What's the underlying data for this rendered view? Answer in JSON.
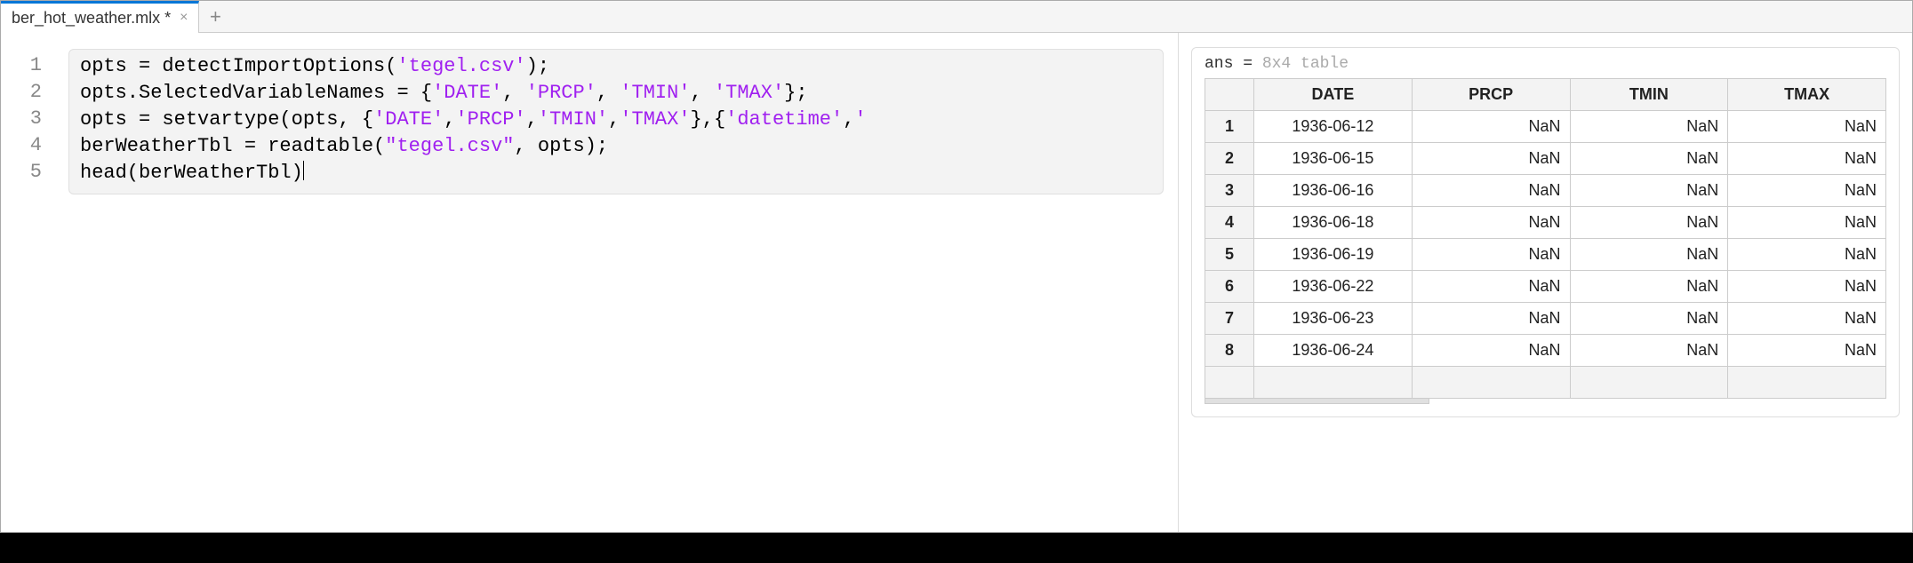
{
  "tab": {
    "filename": "ber_hot_weather.mlx *"
  },
  "editor": {
    "line_numbers": [
      "1",
      "2",
      "3",
      "4",
      "5"
    ],
    "code_lines": [
      [
        {
          "t": "opts = detectImportOptions(",
          "c": "kw"
        },
        {
          "t": "'tegel.csv'",
          "c": "str"
        },
        {
          "t": ");",
          "c": "kw"
        }
      ],
      [
        {
          "t": "opts.SelectedVariableNames = {",
          "c": "kw"
        },
        {
          "t": "'DATE'",
          "c": "str"
        },
        {
          "t": ", ",
          "c": "kw"
        },
        {
          "t": "'PRCP'",
          "c": "str"
        },
        {
          "t": ", ",
          "c": "kw"
        },
        {
          "t": "'TMIN'",
          "c": "str"
        },
        {
          "t": ", ",
          "c": "kw"
        },
        {
          "t": "'TMAX'",
          "c": "str"
        },
        {
          "t": "};",
          "c": "kw"
        }
      ],
      [
        {
          "t": "opts = setvartype(opts, {",
          "c": "kw"
        },
        {
          "t": "'DATE'",
          "c": "str"
        },
        {
          "t": ",",
          "c": "kw"
        },
        {
          "t": "'PRCP'",
          "c": "str"
        },
        {
          "t": ",",
          "c": "kw"
        },
        {
          "t": "'TMIN'",
          "c": "str"
        },
        {
          "t": ",",
          "c": "kw"
        },
        {
          "t": "'TMAX'",
          "c": "str"
        },
        {
          "t": "},{",
          "c": "kw"
        },
        {
          "t": "'datetime'",
          "c": "str"
        },
        {
          "t": ",",
          "c": "kw"
        },
        {
          "t": "'",
          "c": "str"
        }
      ],
      [
        {
          "t": "berWeatherTbl = readtable(",
          "c": "kw"
        },
        {
          "t": "\"tegel.csv\"",
          "c": "str"
        },
        {
          "t": ", opts);",
          "c": "kw"
        }
      ],
      [
        {
          "t": "head(berWeatherTbl)",
          "c": "kw"
        }
      ]
    ]
  },
  "output": {
    "ans_prefix": "ans = ",
    "ans_type": "8x4 table",
    "headers": [
      "DATE",
      "PRCP",
      "TMIN",
      "TMAX"
    ],
    "rows": [
      {
        "n": "1",
        "date": "1936-06-12",
        "prcp": "NaN",
        "tmin": "NaN",
        "tmax": "NaN"
      },
      {
        "n": "2",
        "date": "1936-06-15",
        "prcp": "NaN",
        "tmin": "NaN",
        "tmax": "NaN"
      },
      {
        "n": "3",
        "date": "1936-06-16",
        "prcp": "NaN",
        "tmin": "NaN",
        "tmax": "NaN"
      },
      {
        "n": "4",
        "date": "1936-06-18",
        "prcp": "NaN",
        "tmin": "NaN",
        "tmax": "NaN"
      },
      {
        "n": "5",
        "date": "1936-06-19",
        "prcp": "NaN",
        "tmin": "NaN",
        "tmax": "NaN"
      },
      {
        "n": "6",
        "date": "1936-06-22",
        "prcp": "NaN",
        "tmin": "NaN",
        "tmax": "NaN"
      },
      {
        "n": "7",
        "date": "1936-06-23",
        "prcp": "NaN",
        "tmin": "NaN",
        "tmax": "NaN"
      },
      {
        "n": "8",
        "date": "1936-06-24",
        "prcp": "NaN",
        "tmin": "NaN",
        "tmax": "NaN"
      }
    ]
  }
}
